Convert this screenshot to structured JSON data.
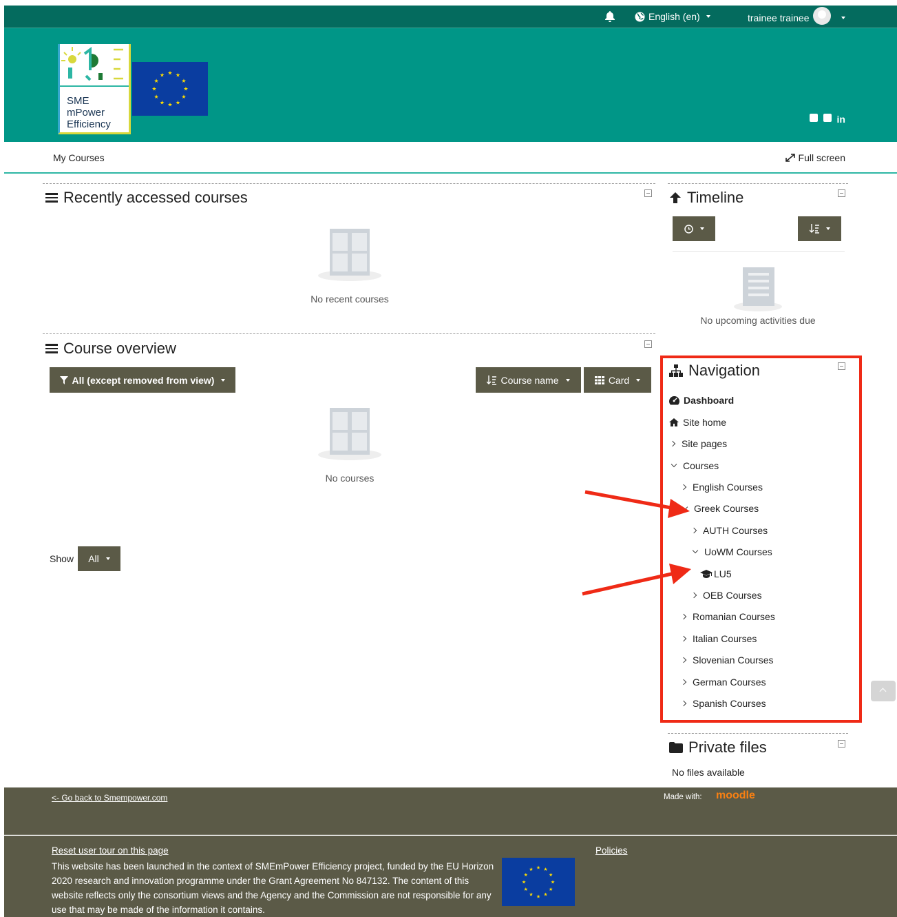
{
  "topbar": {
    "language": "English (en)",
    "user": "trainee trainee"
  },
  "header": {
    "logo_line1": "SME",
    "logo_line2": "mPower",
    "logo_line3": "Efficiency",
    "social": [
      "facebook-icon",
      "twitter-icon",
      "linkedin-icon"
    ],
    "linkedin_label": "in"
  },
  "navrow": {
    "my_courses": "My Courses",
    "full_screen": "Full screen"
  },
  "recent": {
    "title": "Recently accessed courses",
    "empty": "No recent courses"
  },
  "overview": {
    "title": "Course overview",
    "filter": "All (except removed from view)",
    "sort": "Course name",
    "view": "Card",
    "empty": "No courses",
    "show_label": "Show",
    "show_value": "All"
  },
  "timeline": {
    "title": "Timeline",
    "empty": "No upcoming activities due"
  },
  "navigation": {
    "title": "Navigation",
    "items": [
      {
        "label": "Dashboard"
      },
      {
        "label": "Site home"
      },
      {
        "label": "Site pages"
      },
      {
        "label": "Courses"
      },
      {
        "label": "English Courses"
      },
      {
        "label": "Greek Courses"
      },
      {
        "label": "AUTH Courses"
      },
      {
        "label": "UoWM Courses"
      },
      {
        "label": "LU5"
      },
      {
        "label": "OEB Courses"
      },
      {
        "label": "Romanian Courses"
      },
      {
        "label": "Italian Courses"
      },
      {
        "label": "Slovenian Courses"
      },
      {
        "label": "German Courses"
      },
      {
        "label": "Spanish Courses"
      }
    ]
  },
  "private_files": {
    "title": "Private files",
    "empty": "No files available"
  },
  "footer": {
    "back_link": "<- Go back to Smempower.com",
    "made_with": "Made with:",
    "moodle": "moodle",
    "reset_tour": "Reset user tour on this page",
    "policies": "Policies",
    "disclaimer": "This website has been launched in the context of SMEmPower Efficiency project, funded by the EU Horizon 2020 research and innovation programme under the Grant Agreement No 847132. The content of this website reflects only the consortium views and the Agency and the Commission are not responsible for any use that may be made of the information it contains."
  },
  "colors": {
    "topbar": "#046b5e",
    "header": "#009687",
    "dark_button": "#5b5a47",
    "annotation_red": "#ef2a16"
  }
}
